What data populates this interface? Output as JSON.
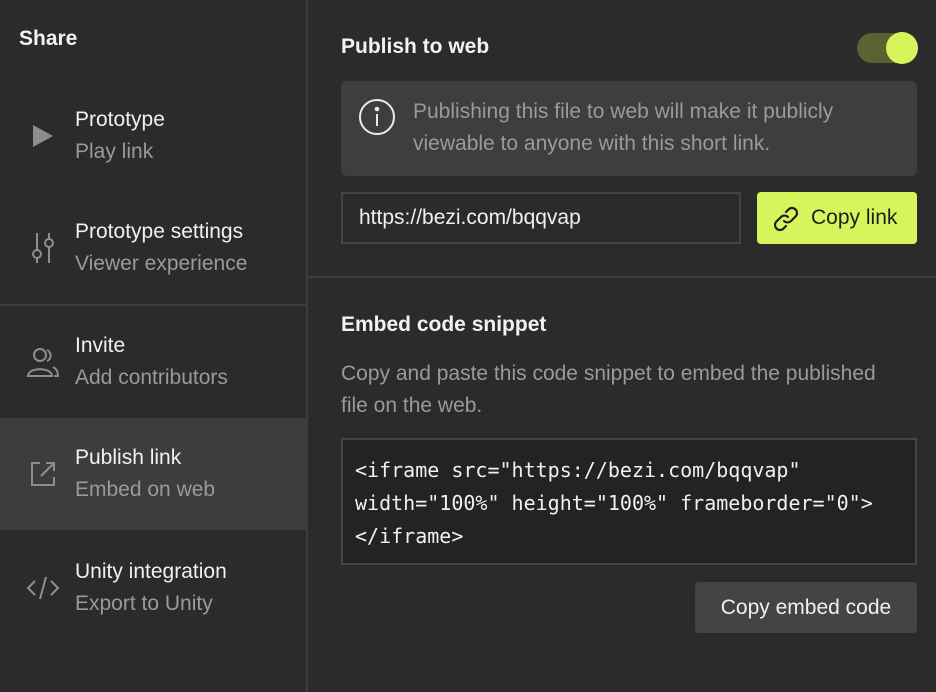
{
  "sidebar": {
    "title": "Share",
    "items": [
      {
        "label": "Prototype",
        "sub": "Play link",
        "icon": "play-icon"
      },
      {
        "label": "Prototype settings",
        "sub": "Viewer experience",
        "icon": "sliders-icon"
      },
      {
        "label": "Invite",
        "sub": "Add contributors",
        "icon": "users-icon"
      },
      {
        "label": "Publish link",
        "sub": "Embed on web",
        "icon": "external-link-icon",
        "active": true
      },
      {
        "label": "Unity integration",
        "sub": "Export to Unity",
        "icon": "code-icon"
      }
    ]
  },
  "publish": {
    "title": "Publish to web",
    "toggle_on": true,
    "info": "Publishing this file to web will make it publicly viewable to anyone with this short link.",
    "url": "https://bezi.com/bqqvap",
    "copy_link_label": "Copy link"
  },
  "embed": {
    "title": "Embed code snippet",
    "description": "Copy and paste this code snippet to embed the published file on the web.",
    "code": "<iframe src=\"https://bezi.com/bqqvap\" width=\"100%\" height=\"100%\" frameborder=\"0\"></iframe>",
    "copy_embed_label": "Copy embed code"
  },
  "colors": {
    "accent": "#d8f45c",
    "background": "#2b2b2b",
    "active_item": "#3d3d3d"
  }
}
